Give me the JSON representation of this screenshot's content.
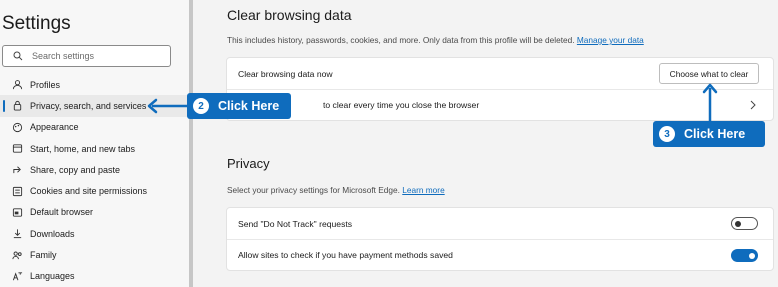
{
  "sidebar": {
    "title": "Settings",
    "search_placeholder": "Search settings",
    "items": [
      {
        "label": "Profiles",
        "icon": "profile-icon"
      },
      {
        "label": "Privacy, search, and services",
        "icon": "lock-icon",
        "active": true
      },
      {
        "label": "Appearance",
        "icon": "appearance-icon"
      },
      {
        "label": "Start, home, and new tabs",
        "icon": "home-tabs-icon"
      },
      {
        "label": "Share, copy and paste",
        "icon": "share-icon"
      },
      {
        "label": "Cookies and site permissions",
        "icon": "cookies-icon"
      },
      {
        "label": "Default browser",
        "icon": "browser-icon"
      },
      {
        "label": "Downloads",
        "icon": "download-icon"
      },
      {
        "label": "Family",
        "icon": "family-icon"
      },
      {
        "label": "Languages",
        "icon": "languages-icon"
      }
    ]
  },
  "clear": {
    "heading": "Clear browsing data",
    "desc": "This includes history, passwords, cookies, and more. Only data from this profile will be deleted.",
    "manage_link": "Manage your data",
    "row1_label": "Clear browsing data now",
    "button": "Choose what to clear",
    "row2_label": "to clear every time you close the browser"
  },
  "privacy": {
    "heading": "Privacy",
    "desc": "Select your privacy settings for Microsoft Edge.",
    "learn_link": "Learn more",
    "row1_label": "Send \"Do Not Track\" requests",
    "row1_on": false,
    "row2_label": "Allow sites to check if you have payment methods saved",
    "row2_on": true
  },
  "callouts": {
    "c2_num": "2",
    "c2_text": "Click Here",
    "c3_num": "3",
    "c3_text": "Click Here"
  },
  "colors": {
    "accent": "#0f6cbd"
  }
}
